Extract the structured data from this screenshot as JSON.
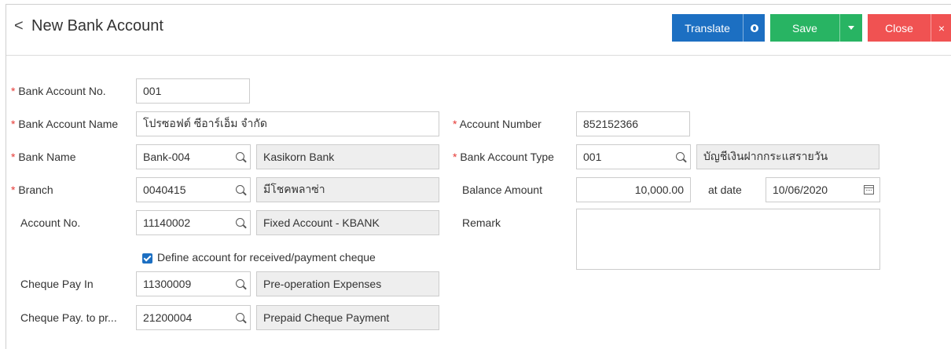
{
  "header": {
    "back_symbol": "<",
    "title": "New Bank Account",
    "translate_label": "Translate",
    "save_label": "Save",
    "close_label": "Close",
    "close_symbol": "×"
  },
  "form": {
    "bank_account_no": {
      "required": "*",
      "label": "Bank Account No.",
      "value": "001"
    },
    "bank_account_name": {
      "required": "*",
      "label": "Bank Account Name",
      "value": "โปรซอฟต์ ซีอาร์เอ็ม จำกัด"
    },
    "bank_name": {
      "required": "*",
      "label": "Bank Name",
      "code": "Bank-004",
      "desc": "Kasikorn Bank"
    },
    "branch": {
      "required": "*",
      "label": "Branch",
      "code": "0040415",
      "desc": "มีโชคพลาซ่า"
    },
    "account_no": {
      "label": "Account No.",
      "code": "11140002",
      "desc": "Fixed Account - KBANK"
    },
    "define_cheque": {
      "label": "Define account for received/payment cheque",
      "checked": true
    },
    "cheque_pay_in": {
      "label": "Cheque Pay In",
      "code": "11300009",
      "desc": "Pre-operation Expenses"
    },
    "cheque_pay_to": {
      "label": "Cheque Pay. to pr...",
      "code": "21200004",
      "desc": "Prepaid Cheque Payment"
    },
    "account_number": {
      "required": "*",
      "label": "Account Number",
      "value": "852152366"
    },
    "bank_account_type": {
      "required": "*",
      "label": "Bank Account Type",
      "code": "001",
      "desc": "บัญชีเงินฝากกระแสรายวัน"
    },
    "balance_amount": {
      "label": "Balance Amount",
      "value": "10,000.00"
    },
    "at_date": {
      "label": "at date",
      "value": "10/06/2020"
    },
    "remark": {
      "label": "Remark",
      "value": ""
    }
  },
  "colors": {
    "translate": "#1c6fc2",
    "save": "#28b463",
    "close": "#f05252",
    "required": "#e53935"
  }
}
